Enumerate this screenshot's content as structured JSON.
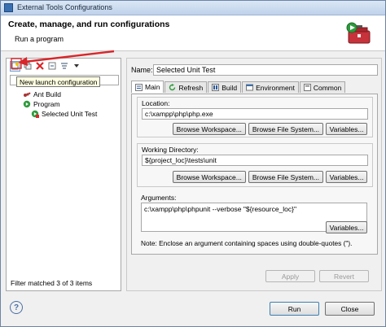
{
  "window": {
    "title": "External Tools Configurations"
  },
  "banner": {
    "heading": "Create, manage, and run configurations",
    "subtitle": "Run a program",
    "icon": "toolbox-icon"
  },
  "left": {
    "toolbar": [
      {
        "icon": "new-launch-configuration-icon"
      },
      {
        "icon": "duplicate-icon"
      },
      {
        "icon": "delete-icon"
      },
      {
        "icon": "collapse-all-icon"
      },
      {
        "icon": "filter-icon"
      },
      {
        "icon": "dropdown-icon"
      }
    ],
    "tooltip": "New launch configuration",
    "filter_value": "",
    "tree": [
      {
        "label": "Ant Build",
        "icon": "ant-icon"
      },
      {
        "label": "Program",
        "icon": "program-icon"
      },
      {
        "label": "Selected Unit Test",
        "icon": "program-config-icon"
      }
    ],
    "status": "Filter matched 3 of 3 items"
  },
  "right": {
    "name_label": "Name:",
    "name_value": "Selected Unit Test",
    "tabs": [
      {
        "label": "Main",
        "icon": "main-tab-icon",
        "active": true
      },
      {
        "label": "Refresh",
        "icon": "refresh-icon"
      },
      {
        "label": "Build",
        "icon": "build-icon"
      },
      {
        "label": "Environment",
        "icon": "environment-icon"
      },
      {
        "label": "Common",
        "icon": "common-icon"
      }
    ],
    "location": {
      "label": "Location:",
      "value": "c:\\xampp\\php\\php.exe",
      "buttons": [
        "Browse Workspace...",
        "Browse File System...",
        "Variables..."
      ]
    },
    "working_dir": {
      "label": "Working Directory:",
      "value": "${project_loc}\\tests\\unit",
      "buttons": [
        "Browse Workspace...",
        "Browse File System...",
        "Variables..."
      ]
    },
    "arguments": {
      "label": "Arguments:",
      "value": "c:\\xampp\\php\\phpunit --verbose \"${resource_loc}\"",
      "variables_button": "Variables...",
      "note": "Note: Enclose an argument containing spaces using double-quotes (\")."
    },
    "apply": "Apply",
    "revert": "Revert"
  },
  "bottom": {
    "run": "Run",
    "close": "Close"
  },
  "colors": {
    "accent": "#3c7fb1",
    "annotation_arrow": "#d9262a",
    "delete": "#d9262a",
    "run_green": "#2e9b3c"
  }
}
